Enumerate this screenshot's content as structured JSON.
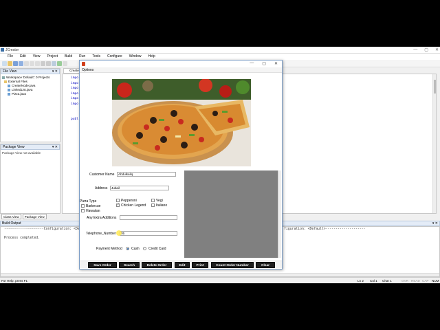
{
  "ide": {
    "title": "JCreator",
    "window_buttons": [
      "—",
      "▢",
      "✕"
    ],
    "menu": [
      "File",
      "Edit",
      "View",
      "Project",
      "Build",
      "Run",
      "Tools",
      "Configure",
      "Window",
      "Help"
    ],
    "file_view": {
      "title": "File View",
      "workspace": "Workspace 'Default': 0 Projects",
      "external_files": "External Files",
      "files": [
        "CreateNode.java",
        "LinkedList.java",
        "Pizza.java"
      ]
    },
    "package_view": {
      "title": "Package View",
      "message": "Package View not available"
    },
    "left_tabs": [
      "Class View",
      "Package View"
    ],
    "editor_tab": "Create",
    "code_lines": [
      "impo",
      "impo",
      "impo",
      "impo",
      "impo",
      "impo",
      "",
      "",
      "publ"
    ],
    "build_output": {
      "title": "Build Output",
      "line1": "--------------------Configuration: <Default>--------------------",
      "line1_right": "figuration: <Default>--------------------",
      "line2": "Process completed."
    },
    "status": {
      "left": "For Help, press F1",
      "ln": "Ln 2",
      "col": "Col 1",
      "char": "Char 1",
      "ovr": "OVR",
      "read": "READ",
      "cap": "CAP",
      "num": "NUM"
    }
  },
  "dialog": {
    "menu_label": "Options",
    "window_buttons": [
      "—",
      "▢",
      "✕"
    ],
    "customer_name_label": "Customer Name",
    "customer_name_value": "Abdulkaliq",
    "address_label": "Address",
    "address_value": "Jubail",
    "pizza_type_label": "Pizza Type",
    "pizza_types": [
      {
        "label": "Barbecue",
        "checked": false
      },
      {
        "label": "Hawaiian",
        "checked": false
      },
      {
        "label": "Pepperoni",
        "checked": false
      },
      {
        "label": "Chicken Legend",
        "checked": true
      },
      {
        "label": "Vegi",
        "checked": false
      },
      {
        "label": "Italiano",
        "checked": false
      }
    ],
    "extra_additions_label": "Any Extra Additions",
    "extra_additions_value": "",
    "telephone_label": "Telephone_Number",
    "telephone_value": "05",
    "payment_method_label": "Payment Method",
    "payment_options": [
      {
        "label": "Cash",
        "checked": true
      },
      {
        "label": "Credit Card",
        "checked": false
      }
    ],
    "buttons": [
      "Save Order",
      "Search",
      "Delete Order",
      "Edit",
      "Print",
      "Count Order Number",
      "Clear"
    ],
    "colors": {
      "button_bg": "#1e1e1e",
      "panel_gray": "#808080",
      "title_border": "#7a9cc5"
    }
  }
}
